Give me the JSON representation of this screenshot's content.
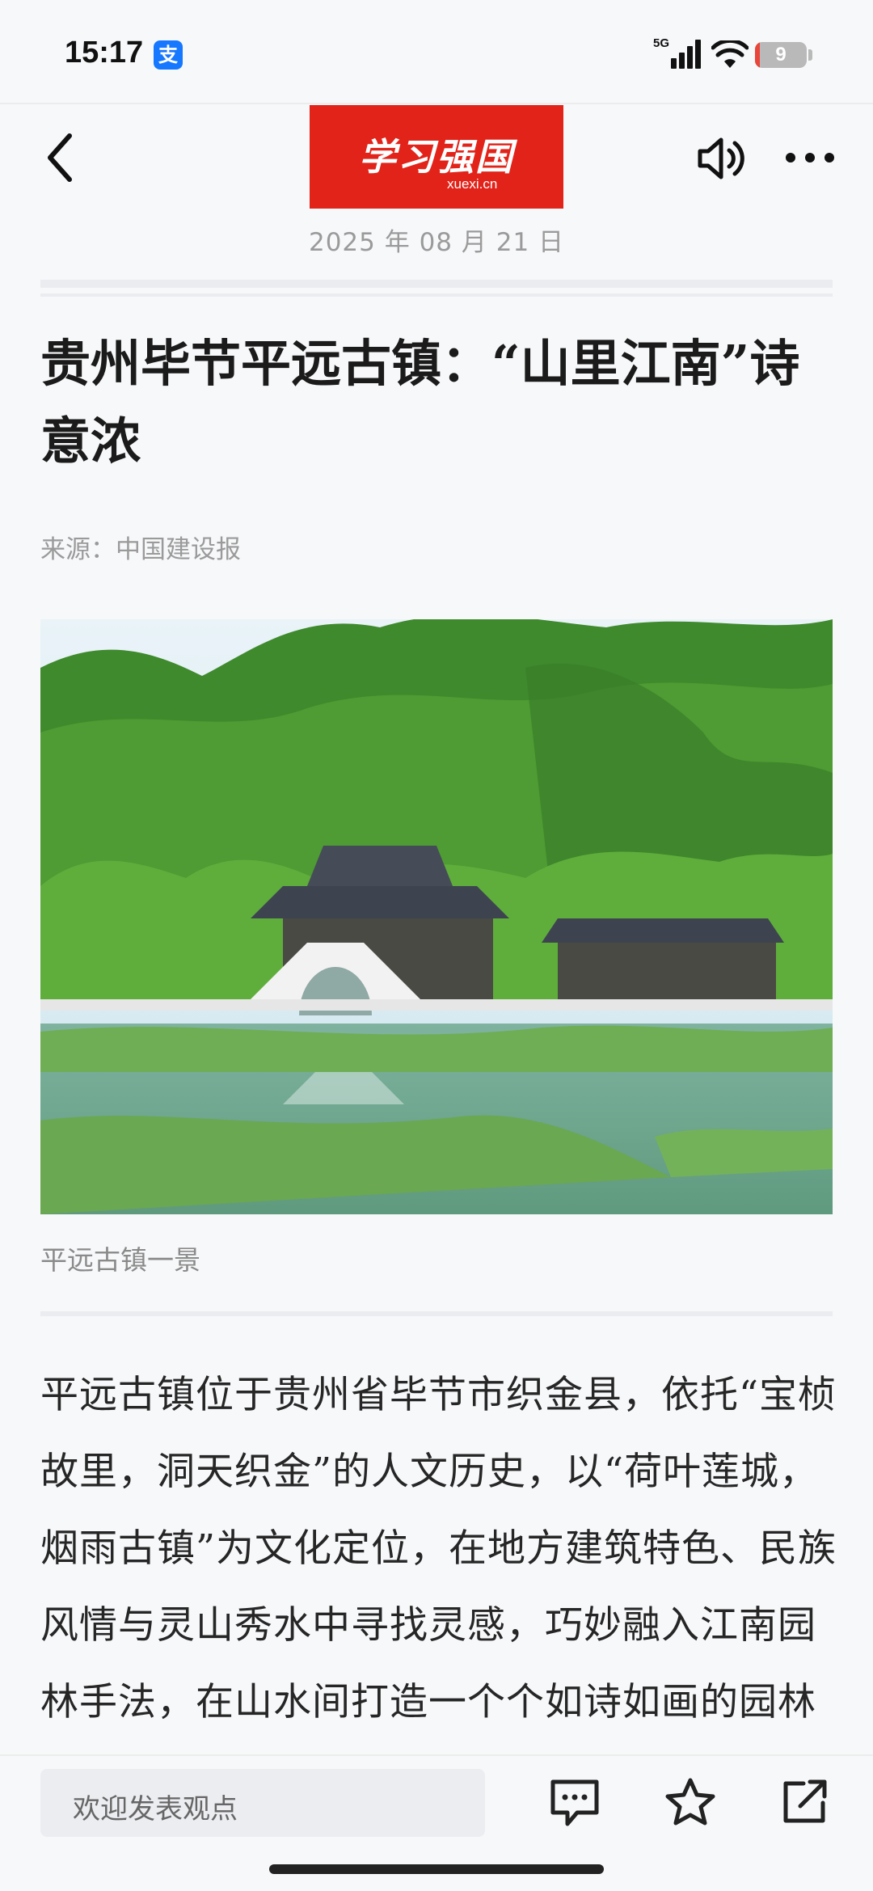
{
  "status_bar": {
    "time": "15:17",
    "app_icon_glyph": "支",
    "network_label": "5G",
    "battery_level": "9",
    "battery_fraction": 0.09
  },
  "nav": {
    "back_icon": "chevron-left-icon",
    "logo_main": "学习强国",
    "logo_sub": "xuexi.cn",
    "speaker_icon": "speaker-icon",
    "more_icon": "more-dots-icon",
    "date": "2025 年 08 月 21 日"
  },
  "article": {
    "title": "贵州毕节平远古镇：“山里江南”诗意浓",
    "source": "来源：中国建设报",
    "image_caption": "平远古镇一景",
    "body": "平远古镇位于贵州省毕节市织金县，依托“宝桢故里，洞天织金”的人文历史，以“荷叶莲城，烟雨古镇”为文化定位，在地方建筑特色、民族风情与灵山秀水中寻找灵感，巧妙融入江南园林手法，在山水间打造一个个如诗如画的园林景观节点。"
  },
  "bottom_bar": {
    "comment_placeholder": "欢迎发表观点",
    "comment_icon": "comment-icon",
    "favorite_icon": "star-icon",
    "share_icon": "share-icon"
  },
  "colors": {
    "brand_red": "#e2231a",
    "battery_low": "#e9453a",
    "background": "#f7f8fa"
  }
}
